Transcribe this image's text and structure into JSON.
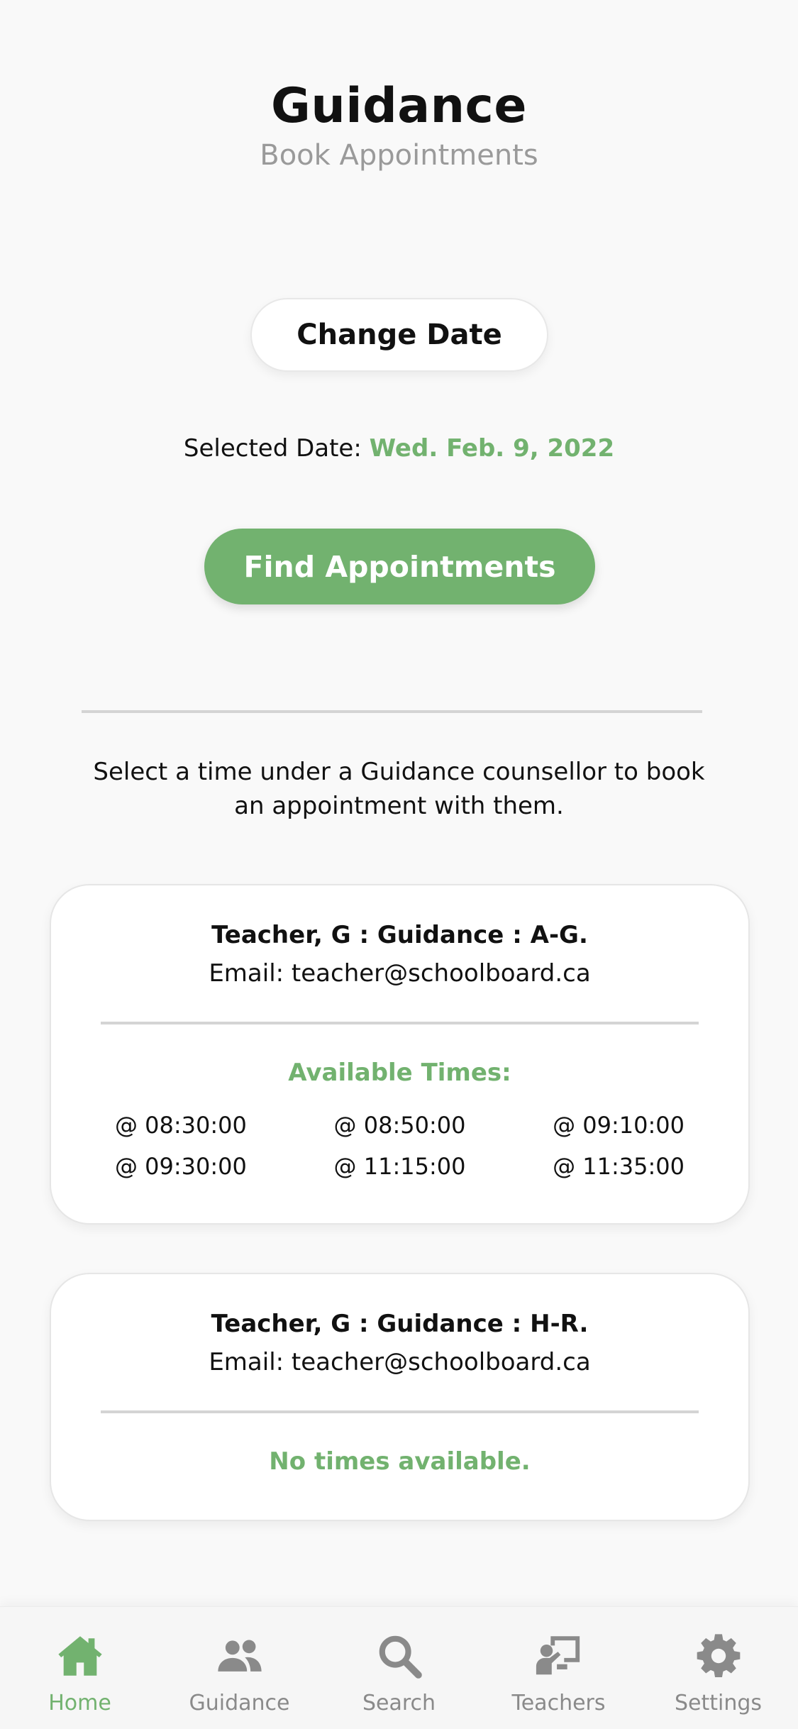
{
  "header": {
    "title": "Guidance",
    "subtitle": "Book Appointments"
  },
  "date_picker": {
    "change_label": "Change Date",
    "selected_prefix": "Selected Date: ",
    "selected_value": "Wed. Feb. 9, 2022"
  },
  "find_button_label": "Find Appointments",
  "instructions": "Select a time under a Guidance counsellor to book an appointment with them.",
  "counsellors": [
    {
      "name": "Teacher, G : Guidance : A-G.",
      "email": "Email: teacher@schoolboard.ca",
      "times_label": "Available Times:",
      "times": [
        "@ 08:30:00",
        "@ 08:50:00",
        "@ 09:10:00",
        "@ 09:30:00",
        "@ 11:15:00",
        "@ 11:35:00"
      ]
    },
    {
      "name": "Teacher, G : Guidance : H-R.",
      "email": "Email: teacher@schoolboard.ca",
      "no_times": "No times available."
    }
  ],
  "tabs": [
    {
      "label": "Home",
      "icon": "home-icon",
      "active": true
    },
    {
      "label": "Guidance",
      "icon": "users-icon",
      "active": false
    },
    {
      "label": "Search",
      "icon": "search-icon",
      "active": false
    },
    {
      "label": "Teachers",
      "icon": "teacher-icon",
      "active": false
    },
    {
      "label": "Settings",
      "icon": "gear-icon",
      "active": false
    }
  ],
  "colors": {
    "accent": "#72b26f",
    "muted": "#8a8a8a",
    "background": "#f9f9f9"
  }
}
